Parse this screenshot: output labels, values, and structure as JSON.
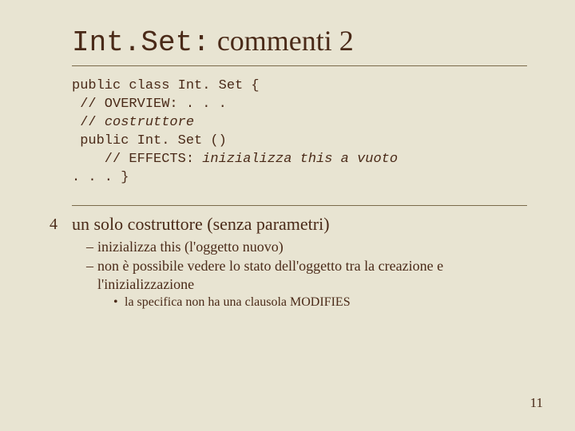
{
  "title": {
    "mono": "Int.Set:",
    "rest": " commenti 2"
  },
  "code": {
    "l1": "public class Int. Set {",
    "l2": " // OVERVIEW: . . .",
    "l3_pre": " // ",
    "l3_it": "costruttore",
    "l4": " public Int. Set ()",
    "l5_pre": "    // EFFECTS: ",
    "l5_it": "inizializza this a vuoto",
    "l6": ". . . }"
  },
  "bullets": {
    "b1": "un solo costruttore (senza parametri)",
    "b1a": "inizializza this (l'oggetto nuovo)",
    "b1b": "non è possibile vedere lo stato dell'oggetto tra la creazione e l'inizializzazione",
    "b1b1": "la specifica non ha una clausola MODIFIES"
  },
  "page_number": "11"
}
